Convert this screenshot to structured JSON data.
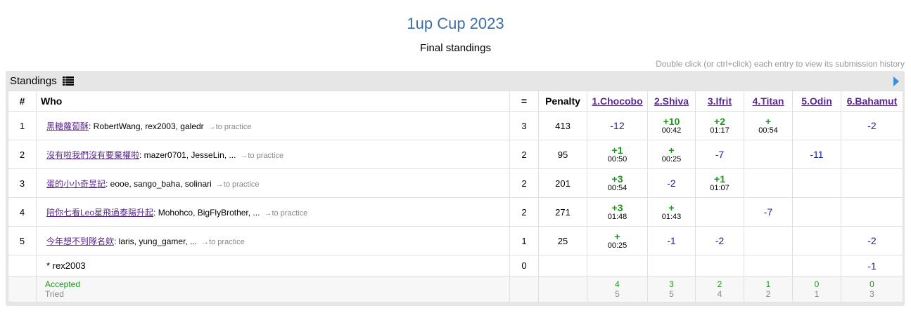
{
  "page": {
    "title": "1up Cup 2023",
    "subtitle": "Final standings",
    "hint": "Double click (or ctrl+click) each entry to view its submission history"
  },
  "panel": {
    "title": "Standings",
    "icon": "list-icon",
    "nav_icon": "arrow-right-icon"
  },
  "headers": {
    "rank": "#",
    "who": "Who",
    "solved": "=",
    "penalty": "Penalty",
    "problems": [
      "1.Chocobo",
      "2.Shiva",
      "3.Ifrit",
      "4.Titan",
      "5.Odin",
      "6.Bahamut"
    ]
  },
  "rows": [
    {
      "rank": "1",
      "team": "黑糖蘿蔔酥",
      "members": ": RobertWang, rex2003, galedr",
      "practice": "→to practice",
      "solved": "3",
      "penalty": "413",
      "cells": [
        {
          "v": "-12",
          "t": ""
        },
        {
          "v": "+10",
          "t": "00:42"
        },
        {
          "v": "+2",
          "t": "01:17"
        },
        {
          "v": "+",
          "t": "00:54"
        },
        {
          "v": "",
          "t": ""
        },
        {
          "v": "-2",
          "t": ""
        }
      ]
    },
    {
      "rank": "2",
      "team": "沒有啦我們沒有要棄權啦",
      "members": ": mazer0701, JesseLin, ...",
      "practice": "→to practice",
      "solved": "2",
      "penalty": "95",
      "cells": [
        {
          "v": "+1",
          "t": "00:50"
        },
        {
          "v": "+",
          "t": "00:25"
        },
        {
          "v": "-7",
          "t": ""
        },
        {
          "v": "",
          "t": ""
        },
        {
          "v": "-11",
          "t": ""
        },
        {
          "v": "",
          "t": ""
        }
      ]
    },
    {
      "rank": "3",
      "team": "蛋的小小奇昱記",
      "members": ": eooe, sango_baha, solinari",
      "practice": "→to practice",
      "solved": "2",
      "penalty": "201",
      "cells": [
        {
          "v": "+3",
          "t": "00:54"
        },
        {
          "v": "-2",
          "t": ""
        },
        {
          "v": "+1",
          "t": "01:07"
        },
        {
          "v": "",
          "t": ""
        },
        {
          "v": "",
          "t": ""
        },
        {
          "v": "",
          "t": ""
        }
      ]
    },
    {
      "rank": "4",
      "team": "陪你七看Leo星飛過泰陽升起",
      "members": ": Mohohco, BigFlyBrother, ...",
      "practice": "→to practice",
      "solved": "2",
      "penalty": "271",
      "cells": [
        {
          "v": "+3",
          "t": "01:48"
        },
        {
          "v": "+",
          "t": "01:43"
        },
        {
          "v": "",
          "t": ""
        },
        {
          "v": "-7",
          "t": ""
        },
        {
          "v": "",
          "t": ""
        },
        {
          "v": "",
          "t": ""
        }
      ]
    },
    {
      "rank": "5",
      "team": "今年想不到隊名欸",
      "members": ": laris, yung_gamer, ...",
      "practice": "→to practice",
      "solved": "1",
      "penalty": "25",
      "cells": [
        {
          "v": "+",
          "t": "00:25"
        },
        {
          "v": "-1",
          "t": ""
        },
        {
          "v": "-2",
          "t": ""
        },
        {
          "v": "",
          "t": ""
        },
        {
          "v": "",
          "t": ""
        },
        {
          "v": "-2",
          "t": ""
        }
      ]
    }
  ],
  "extra": {
    "who": "* rex2003",
    "solved": "0",
    "cells": [
      "",
      "",
      "",
      "",
      "",
      "-1"
    ]
  },
  "summary": {
    "accepted_label": "Accepted",
    "tried_label": "Tried",
    "accepted": [
      "4",
      "3",
      "2",
      "1",
      "0",
      "0"
    ],
    "tried": [
      "5",
      "5",
      "4",
      "2",
      "1",
      "3"
    ]
  },
  "colors": {
    "title": "#3d6ea8",
    "accepted": "#1a9a1a",
    "rejected": "#2020a0",
    "link": "#5a2a8a"
  }
}
